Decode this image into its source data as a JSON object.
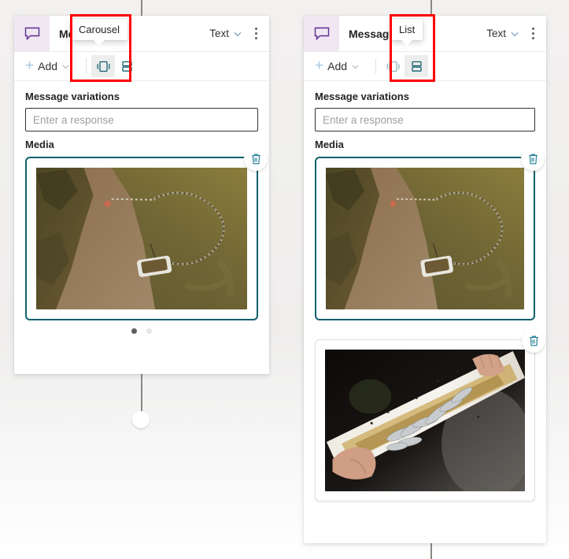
{
  "canvas": {
    "background_color": "#f2f1f0",
    "connector_color": "#8a8886"
  },
  "nodes": [
    {
      "id": "left",
      "header": {
        "icon": "chat-bubble-icon",
        "icon_color": "#5b2d8e",
        "icon_background": "#f0e7f3",
        "title": "Message",
        "type_label": "Text",
        "chevron": "chevron-down-icon",
        "overflow": "kebab-menu-icon"
      },
      "toolbar": {
        "add_label": "Add",
        "add_icon": "plus-icon",
        "add_chevron": "chevron-down-icon",
        "carousel_icon": "carousel-layout-icon",
        "list_icon": "list-layout-icon",
        "selected": "carousel"
      },
      "body": {
        "variations_label": "Message variations",
        "response_value": "",
        "response_placeholder": "Enter a response",
        "media_label": "Media",
        "cards": [
          {
            "active": true,
            "delete_icon": "trash-icon",
            "image": "aerial-boat-shoreline"
          }
        ],
        "carousel_dots": [
          {
            "state": "active"
          },
          {
            "state": "inactive"
          }
        ]
      },
      "tooltip": {
        "text": "Carousel",
        "visible": true
      },
      "highlight": {
        "color": "#ff0000",
        "visible": true
      }
    },
    {
      "id": "right",
      "header": {
        "icon": "chat-bubble-icon",
        "icon_color": "#5b2d8e",
        "icon_background": "#f0e7f3",
        "title": "Message",
        "type_label": "Text",
        "chevron": "chevron-down-icon",
        "overflow": "kebab-menu-icon"
      },
      "toolbar": {
        "add_label": "Add",
        "add_icon": "plus-icon",
        "add_chevron": "chevron-down-icon",
        "carousel_icon": "carousel-layout-icon",
        "list_icon": "list-layout-icon",
        "selected": "list"
      },
      "body": {
        "variations_label": "Message variations",
        "response_value": "",
        "response_placeholder": "Enter a response",
        "media_label": "Media",
        "cards": [
          {
            "active": true,
            "delete_icon": "trash-icon",
            "image": "aerial-boat-shoreline"
          },
          {
            "active": false,
            "delete_icon": "trash-icon",
            "image": "fish-in-trough"
          }
        ],
        "carousel_dots": []
      },
      "tooltip": {
        "text": "List",
        "visible": true
      },
      "highlight": {
        "color": "#ff0000",
        "visible": true
      }
    }
  ]
}
